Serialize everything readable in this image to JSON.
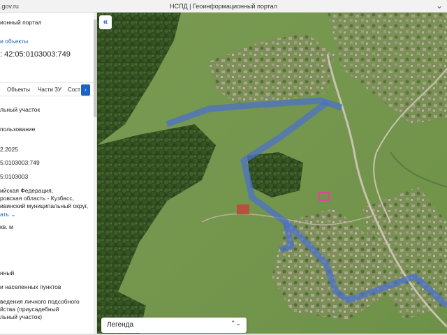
{
  "browser": {
    "url": ".gov.ru",
    "title": "НСПД | Геоинформационный портал",
    "menu_icon": "chevron-down-icon"
  },
  "sidebar": {
    "portal_title": "ионный портал",
    "objects_link": "и объекты",
    "cadastral_header": ": 42:05:0103003:749",
    "tabs": {
      "objects": "Объекты",
      "parts": "Части ЗУ",
      "composition": "Сост"
    },
    "fields": {
      "object_type": "льный участок",
      "usage": "пользование",
      "date": "2.2025",
      "cad_number": "5:0103003:749",
      "quarter": "5:0103003",
      "address_1": "ийская Федерация,",
      "address_2": "ровская область - Кузбасс,",
      "address_3": "ивинский муниципальный округ,",
      "show_more": "ать",
      "area": "кв. м",
      "status": "нный",
      "category": "и населенных пунктов",
      "permitted_use_1": "ведения личного подсобного",
      "permitted_use_2": "йства (приусадебный",
      "permitted_use_3": "льный участок)"
    }
  },
  "map": {
    "collapse_label": "«",
    "legend_label": "Легенда",
    "legend_arrows": "⌃⌄"
  },
  "colors": {
    "link": "#1a63c4",
    "route": "#4a6fd0",
    "parcel": "#e0459a"
  }
}
